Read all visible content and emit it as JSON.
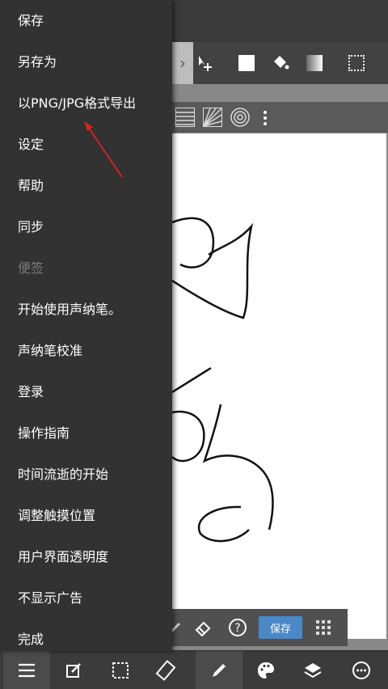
{
  "menu": {
    "items": [
      {
        "label": "保存",
        "enabled": true
      },
      {
        "label": "另存为",
        "enabled": true
      },
      {
        "label": "以PNG/JPG格式导出",
        "enabled": true
      },
      {
        "label": "设定",
        "enabled": true
      },
      {
        "label": "帮助",
        "enabled": true
      },
      {
        "label": "同步",
        "enabled": true
      },
      {
        "label": "便签",
        "enabled": false
      },
      {
        "label": "开始使用声纳笔。",
        "enabled": true
      },
      {
        "label": "声纳笔校准",
        "enabled": true
      },
      {
        "label": "登录",
        "enabled": true
      },
      {
        "label": "操作指南",
        "enabled": true
      },
      {
        "label": "时间流逝的开始",
        "enabled": true
      },
      {
        "label": "调整触摸位置",
        "enabled": true
      },
      {
        "label": "用户界面透明度",
        "enabled": true
      },
      {
        "label": "不显示广告",
        "enabled": true
      },
      {
        "label": "完成",
        "enabled": true
      }
    ]
  },
  "floating_toolbar": {
    "save_label": "保存"
  },
  "toolbar": {
    "next_glyph": "›"
  },
  "colors": {
    "accent_button": "#4a88c7",
    "annotation_arrow": "#e02020",
    "menu_bg": "#323232"
  }
}
